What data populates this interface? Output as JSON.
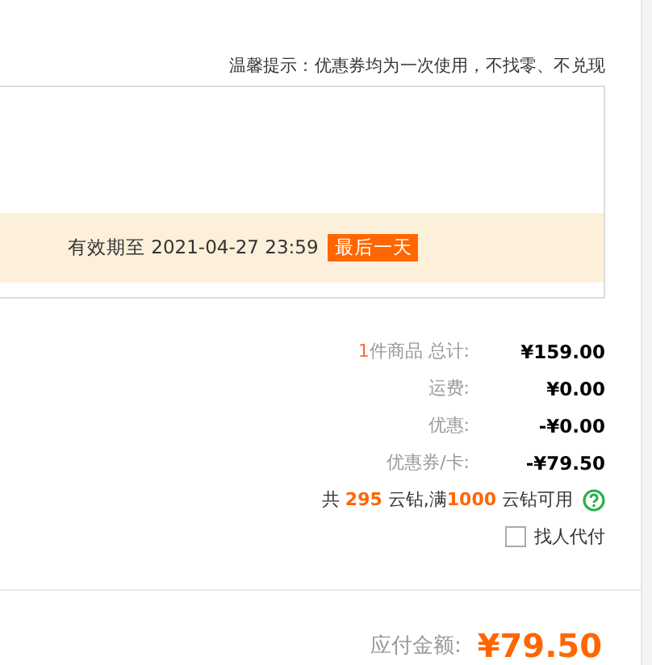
{
  "notice": "温馨提示：优惠券均为一次使用，不找零、不兑现",
  "coupon": {
    "expiry": "有效期至 2021-04-27 23:59",
    "badge": "最后一天"
  },
  "summary": [
    {
      "label": [
        {
          "text": "1",
          "emphasis": true
        },
        {
          "text": "件商品 总计:",
          "emphasis": false
        }
      ],
      "value": "¥159.00"
    },
    {
      "label": [
        {
          "text": "运费:",
          "emphasis": false
        }
      ],
      "value": "¥0.00"
    },
    {
      "label": [
        {
          "text": "优惠:",
          "emphasis": false
        }
      ],
      "value": "-¥0.00"
    },
    {
      "label": [
        {
          "text": "优惠券/卡:",
          "emphasis": false
        }
      ],
      "value": "-¥79.50"
    }
  ],
  "points": [
    {
      "text": "共 ",
      "emphasis": false
    },
    {
      "text": "295",
      "emphasis": true
    },
    {
      "text": " 云钻,满",
      "emphasis": false
    },
    {
      "text": "1000",
      "emphasis": true
    },
    {
      "text": " 云钻可用",
      "emphasis": false
    }
  ],
  "proxy_pay": {
    "label": "找人代付",
    "checked": false
  },
  "payable": {
    "label": "应付金额:",
    "value": "¥79.50"
  }
}
